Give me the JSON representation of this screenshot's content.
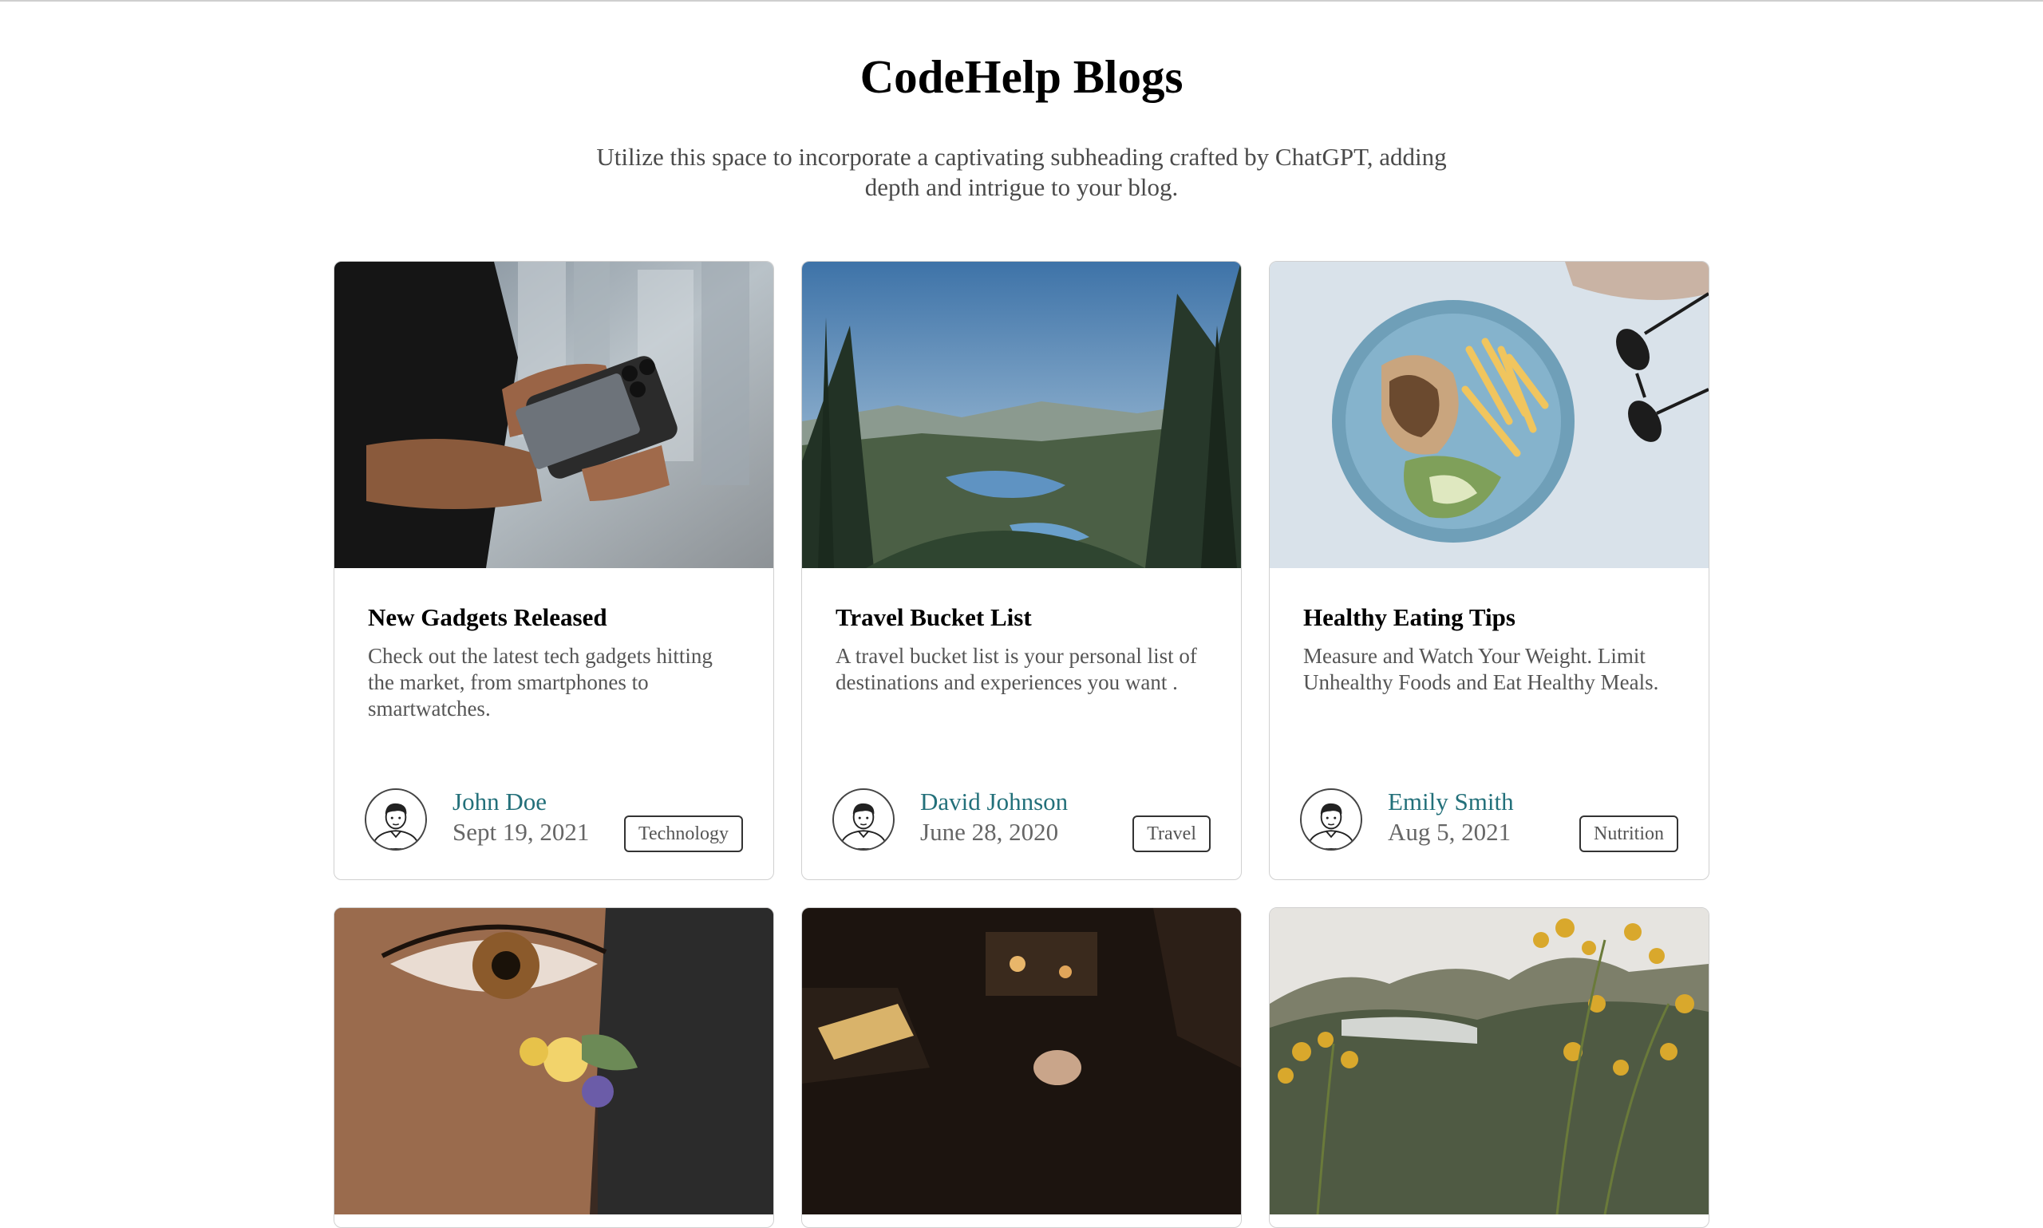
{
  "header": {
    "title": "CodeHelp Blogs",
    "subtitle": "Utilize this space to incorporate a captivating subheading crafted by ChatGPT, adding depth and intrigue to your blog."
  },
  "posts": [
    {
      "title": "New Gadgets Released",
      "excerpt": "Check out the latest tech gadgets hitting the market, from smartphones to smartwatches.",
      "author": "John Doe",
      "date": "Sept 19, 2021",
      "tag": "Technology",
      "image": "smartphone-with-external-ssd-photo"
    },
    {
      "title": "Travel Bucket List",
      "excerpt": "A travel bucket list is your personal list of destinations and experiences you want .",
      "author": "David Johnson",
      "date": "June 28, 2020",
      "tag": "Travel",
      "image": "forest-valley-lake-photo"
    },
    {
      "title": "Healthy Eating Tips",
      "excerpt": "Measure and Watch Your Weight. Limit Unhealthy Foods and Eat Healthy Meals.",
      "author": "Emily Smith",
      "date": "Aug 5, 2021",
      "tag": "Nutrition",
      "image": "plate-of-chicken-and-fries-photo"
    },
    {
      "image": "eye-with-flowers-photo"
    },
    {
      "image": "dark-cozy-room-photo"
    },
    {
      "image": "misty-mountain-flowers-photo"
    }
  ],
  "colors": {
    "author": "#23707a",
    "border": "#d0d0d0",
    "text_muted": "#555555"
  }
}
